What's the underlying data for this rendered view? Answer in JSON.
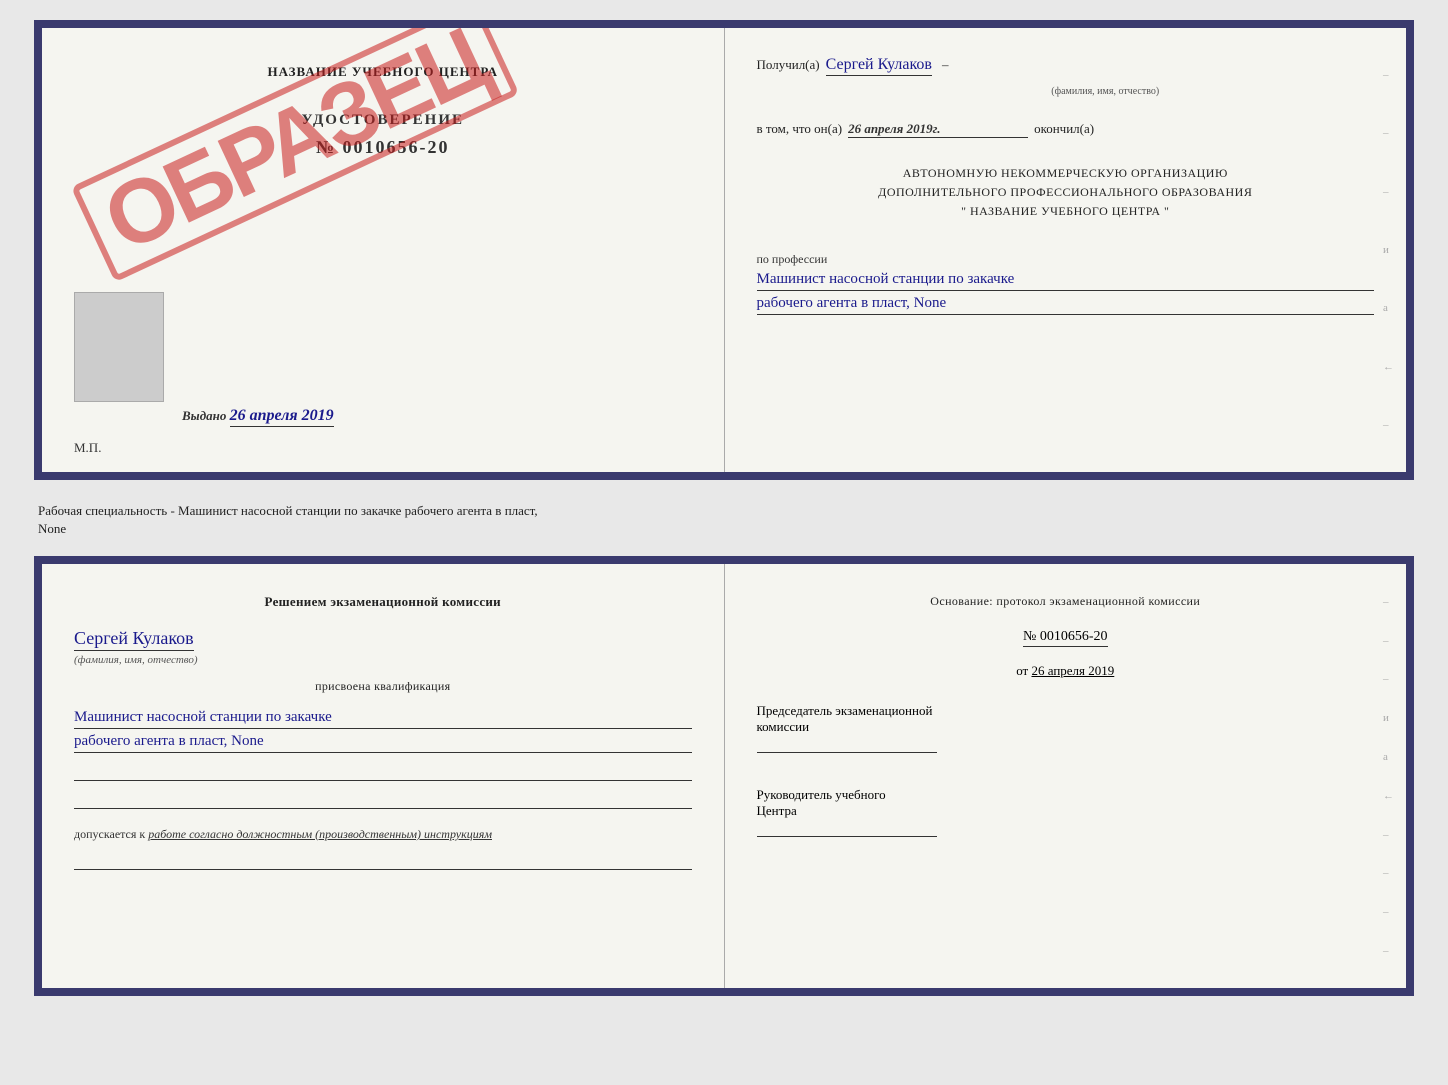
{
  "top_left": {
    "training_center_title": "НАЗВАНИЕ УЧЕБНОГО ЦЕНТРА",
    "cert_label": "УДОСТОВЕРЕНИЕ",
    "cert_number": "№ 0010656-20",
    "stamp_text": "ОБРАЗЕЦ",
    "issued_label": "Выдано",
    "issued_date": "26 апреля 2019",
    "mp_label": "М.П."
  },
  "top_right": {
    "received_prefix": "Получил(а)",
    "recipient_name": "Сергей Кулаков",
    "recipient_sublabel": "(фамилия, имя, отчество)",
    "date_prefix": "в том, что он(а)",
    "date_value": "26 апреля 2019г.",
    "finished_label": "окончил(а)",
    "org_line1": "АВТОНОМНУЮ НЕКОММЕРЧЕСКУЮ ОРГАНИЗАЦИЮ",
    "org_line2": "ДОПОЛНИТЕЛЬНОГО ПРОФЕССИОНАЛЬНОГО ОБРАЗОВАНИЯ",
    "org_name_quotes": "\" НАЗВАНИЕ УЧЕБНОГО ЦЕНТРА \"",
    "profession_label": "по профессии",
    "profession_line1": "Машинист насосной станции по закачке",
    "profession_line2": "рабочего агента в пласт, None"
  },
  "separator": {
    "text_line1": "Рабочая специальность - Машинист насосной станции по закачке рабочего агента в пласт,",
    "text_line2": "None"
  },
  "bottom_left": {
    "commission_title": "Решением экзаменационной комиссии",
    "person_name": "Сергей Кулаков",
    "person_sublabel": "(фамилия, имя, отчество)",
    "assigned_label": "присвоена квалификация",
    "qualification_line1": "Машинист насосной станции по закачке",
    "qualification_line2": "рабочего агента в пласт, None",
    "blank_line1": "",
    "blank_line2": "",
    "допуск_prefix": "допускается к",
    "допуск_text": "работе согласно должностным (производственным) инструкциям",
    "blank_line3": ""
  },
  "bottom_right": {
    "basis_title": "Основание: протокол экзаменационной комиссии",
    "protocol_number": "№  0010656-20",
    "date_prefix": "от",
    "date_value": "26 апреля 2019",
    "chairman_line1": "Председатель экзаменационной",
    "chairman_line2": "комиссии",
    "head_line1": "Руководитель учебного",
    "head_line2": "Центра",
    "dashes": [
      "-",
      "-",
      "-",
      "и",
      "а",
      "←",
      "-",
      "-",
      "-",
      "-"
    ]
  }
}
